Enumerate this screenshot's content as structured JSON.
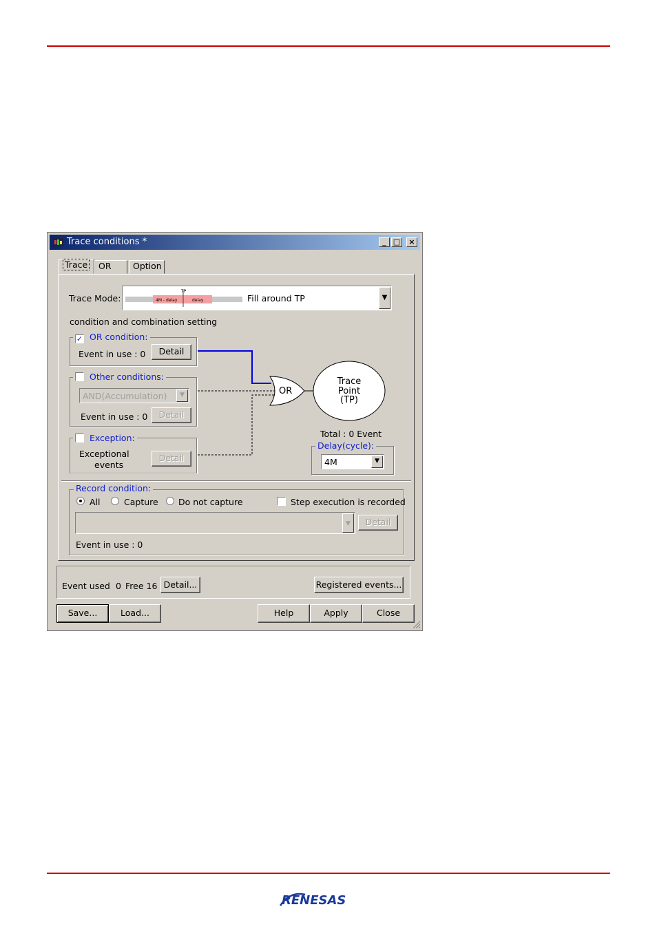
{
  "page": {
    "accent_color": "#cc0000",
    "logo_text": "RENESAS"
  },
  "window": {
    "title": "Trace conditions *",
    "controls": {
      "minimize": "_",
      "maximize": "□",
      "close": "×"
    },
    "tabs": [
      "Trace",
      "OR",
      "Option"
    ],
    "trace_mode": {
      "label": "Trace Mode:",
      "value": "Fill around TP",
      "diagram_tp": "TP",
      "diagram_left": "4M - delay",
      "diagram_right": "delay"
    },
    "section_heading": "condition and combination setting",
    "or_condition": {
      "label": "OR condition:",
      "checked": true,
      "event_in_use": "Event in use :  0",
      "detail": "Detail"
    },
    "other_conditions": {
      "label": "Other conditions:",
      "checked": false,
      "combo_value": "AND(Accumulation)",
      "event_in_use": "Event in use : 0",
      "detail": "Detail"
    },
    "exception": {
      "label": "Exception:",
      "checked": false,
      "text_line1": "Exceptional",
      "text_line2": "events",
      "detail": "Detail"
    },
    "gate": {
      "label": "OR"
    },
    "trace_point": {
      "line1": "Trace",
      "line2": "Point",
      "line3": "(TP)"
    },
    "total": "Total :  0   Event",
    "delay": {
      "label": "Delay(cycle):",
      "value": "4M"
    },
    "record_condition": {
      "label": "Record condition:",
      "options": [
        "All",
        "Capture",
        "Do not capture"
      ],
      "selected": "All",
      "step_execution": "Step execution is recorded",
      "detail": "Detail",
      "event_in_use": "Event in use : 0"
    },
    "footer": {
      "event_used": "Event used",
      "used_count": "0",
      "free": "Free 16",
      "detail": "Detail...",
      "registered": "Registered events..."
    },
    "buttons": {
      "save": "Save...",
      "load": "Load...",
      "help": "Help",
      "apply": "Apply",
      "close": "Close"
    }
  }
}
